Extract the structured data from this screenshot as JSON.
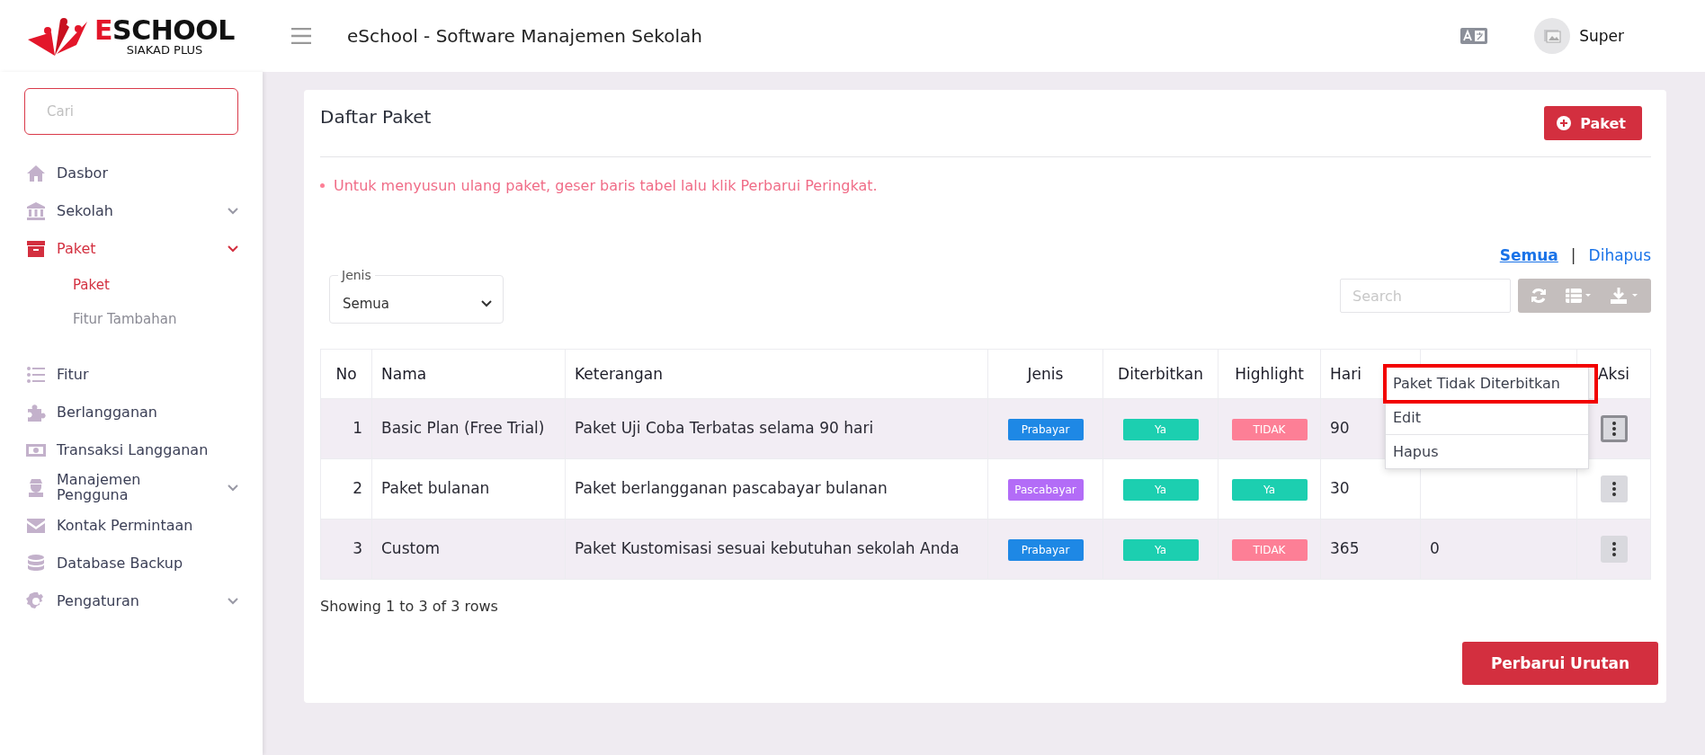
{
  "header": {
    "logo": {
      "initial": "E",
      "rest": "SCHOOL",
      "tagline": "SIAKAD PLUS"
    },
    "title": "eSchool - Software Manajemen Sekolah",
    "user": "Super"
  },
  "sidebar": {
    "search": {
      "placeholder": "Cari"
    },
    "items": [
      {
        "label": "Dasbor",
        "kind": "link",
        "selected": false
      },
      {
        "label": "Sekolah",
        "kind": "group",
        "selected": false
      },
      {
        "label": "Paket",
        "kind": "group",
        "selected": true,
        "children": [
          {
            "label": "Paket",
            "selected": true
          },
          {
            "label": "Fitur Tambahan",
            "selected": false
          }
        ]
      },
      {
        "label": "Fitur",
        "kind": "link",
        "selected": false
      },
      {
        "label": "Berlangganan",
        "kind": "link",
        "selected": false
      },
      {
        "label": "Transaksi Langganan",
        "kind": "link",
        "selected": false
      },
      {
        "label": "Manajemen Pengguna",
        "kind": "group",
        "selected": false
      },
      {
        "label": "Kontak Permintaan",
        "kind": "link",
        "selected": false
      },
      {
        "label": "Database Backup",
        "kind": "link",
        "selected": false
      },
      {
        "label": "Pengaturan",
        "kind": "group",
        "selected": false
      }
    ]
  },
  "card": {
    "title": "Daftar Paket",
    "add_button": "Paket",
    "note": "Untuk menyusun ulang paket, geser baris tabel lalu klik Perbarui Peringkat.",
    "view_links": [
      {
        "label": "Semua",
        "selected": true
      },
      {
        "label": "Dihapus",
        "selected": false
      }
    ],
    "link_separator": "|",
    "filter": {
      "label": "Jenis",
      "value": "Semua"
    },
    "search": {
      "placeholder": "Search"
    },
    "table": {
      "columns": [
        "No",
        "Nama",
        "Keterangan",
        "Jenis",
        "Diterbitkan",
        "Highlight",
        "Hari",
        null,
        "Aksi"
      ],
      "rows": [
        {
          "no": "1",
          "nama": "Basic Plan (Free Trial)",
          "keterangan": "Paket Uji Coba Terbatas selama 90 hari",
          "jenis": {
            "label": "Prabayar",
            "color": "#1e88e5"
          },
          "diterbitkan": {
            "label": "Ya",
            "color": "#1ccfb0"
          },
          "highlight": {
            "label": "TIDAK",
            "color": "#fd7f96"
          },
          "hari": "90",
          "menu_open": true
        },
        {
          "no": "2",
          "nama": "Paket bulanan",
          "keterangan": "Paket berlangganan pascabayar bulanan",
          "jenis": {
            "label": "Pascabayar",
            "color": "#b36cf7"
          },
          "diterbitkan": {
            "label": "Ya",
            "color": "#1ccfb0"
          },
          "highlight": {
            "label": "Ya",
            "color": "#1ccfb0"
          },
          "hari": "30",
          "menu_open": false
        },
        {
          "no": "3",
          "nama": "Custom",
          "keterangan": "Paket Kustomisasi sesuai kebutuhan sekolah Anda",
          "jenis": {
            "label": "Prabayar",
            "color": "#1e88e5"
          },
          "diterbitkan": {
            "label": "Ya",
            "color": "#1ccfb0"
          },
          "highlight": {
            "label": "TIDAK",
            "color": "#fd7f96"
          },
          "hari": "365",
          "column_8": "0",
          "menu_open": false
        }
      ],
      "menu": [
        {
          "label": "Paket Tidak Diterbitkan",
          "highlighted": true
        },
        {
          "label": "Edit",
          "highlighted": false
        },
        {
          "label": "Hapus",
          "highlighted": false
        }
      ]
    },
    "footer_text": "Showing 1 to 3 of 3 rows",
    "save_button": "Perbarui Urutan"
  }
}
